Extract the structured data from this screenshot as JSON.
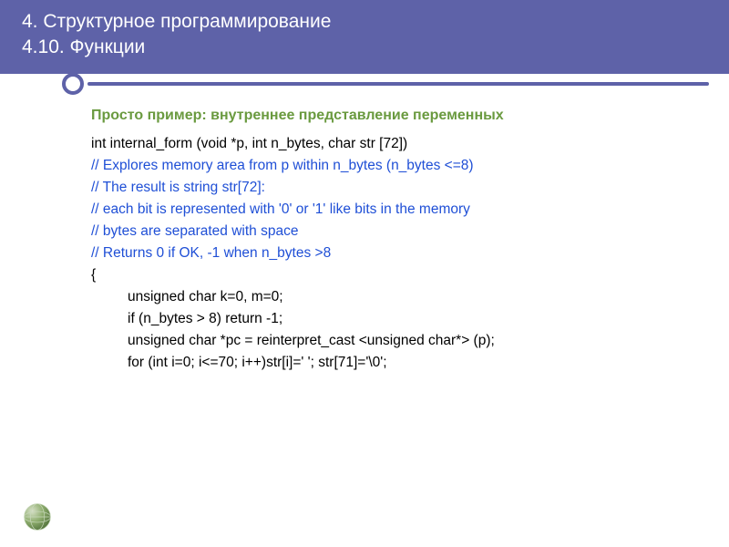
{
  "header": {
    "line1": "4. Структурное программирование",
    "line2": "4.10. Функции"
  },
  "subtitle": "Просто пример: внутреннее представление переменных",
  "code": {
    "l1": "int internal_form (void *p, int n_bytes, char str [72])",
    "l2": "// Explores memory area from p within n_bytes (n_bytes <=8)",
    "l3": "// The result is string str[72]:",
    "l4": "//     each bit is represented with '0' or '1' like bits in the memory",
    "l5": "//     bytes are separated with space",
    "l6": "// Returns 0 if OK, -1 when n_bytes >8",
    "l7": "{",
    "l8": "unsigned char k=0, m=0;",
    "l9": "if (n_bytes > 8) return -1;",
    "l10": "",
    "l11": "unsigned char *pc = reinterpret_cast <unsigned char*> (p);",
    "l12": "for (int i=0; i<=70; i++)str[i]=' '; str[71]='\\0';"
  }
}
